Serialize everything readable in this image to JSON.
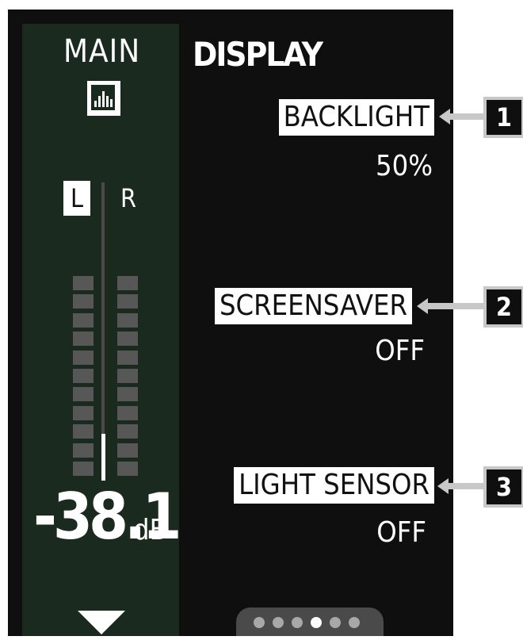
{
  "header": {
    "section_label": "MAIN",
    "page_title": "DISPLAY"
  },
  "meter": {
    "channels": [
      "L",
      "R"
    ],
    "selected_channel": "L",
    "level_db": "-38.1",
    "unit": "dB",
    "segments_per_channel": 11
  },
  "params": [
    {
      "label": "BACKLIGHT",
      "value": "50%",
      "badge": "1"
    },
    {
      "label": "SCREENSAVER",
      "value": "OFF",
      "badge": "2"
    },
    {
      "label": "LIGHT SENSOR",
      "value": "OFF",
      "badge": "3"
    }
  ],
  "pagination": {
    "total": 6,
    "active": 4
  },
  "icons": {
    "section": "equalizer-icon",
    "nav": "down-arrow-icon"
  },
  "colors": {
    "screen_bg": "#0f0f0f",
    "panel_bg": "#1b2a1e",
    "segment": "#575757",
    "accent": "#ffffff",
    "connector": "#c8c8c8"
  }
}
